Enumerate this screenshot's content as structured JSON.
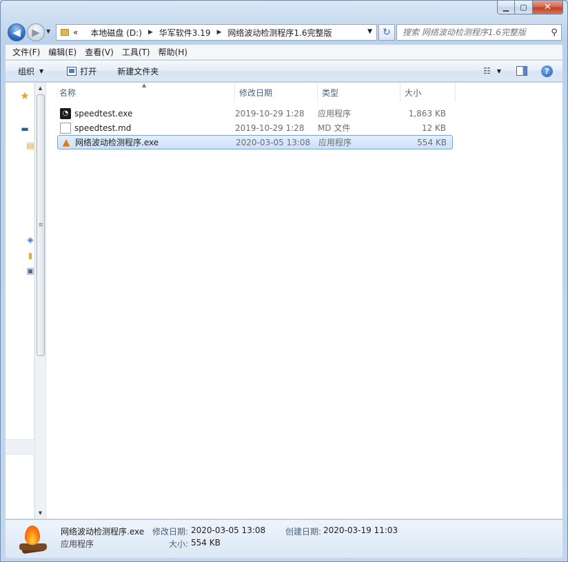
{
  "window": {
    "caption": {
      "minimize": "▁",
      "maximize": "▢",
      "close": "✕"
    }
  },
  "nav": {
    "back": "◀",
    "forward": "▶",
    "history_drop": "▼",
    "breadcrumb": [
      {
        "label": "«"
      },
      {
        "label": "本地磁盘 (D:)"
      },
      {
        "label": "华军软件3.19"
      },
      {
        "label": "网络波动检测程序1.6完整版"
      }
    ],
    "crumb_sep": "▶",
    "address_drop": "▼",
    "refresh": "↻",
    "search_placeholder": "搜索 网络波动检测程序1.6完整版",
    "search_icon": "⚲"
  },
  "menu": [
    "文件(F)",
    "编辑(E)",
    "查看(V)",
    "工具(T)",
    "帮助(H)"
  ],
  "toolbar": {
    "organize": "组织",
    "organize_arrow": "▼",
    "open": "打开",
    "new_folder": "新建文件夹",
    "view_icon": "☷",
    "view_drop": "▼",
    "help": "?"
  },
  "sidebar": {
    "scroll_up": "▲",
    "scroll_down": "▼",
    "thumb_grip": "≡",
    "icons": [
      {
        "name": "favorites-star-icon",
        "glyph": "★",
        "color": "#f0a020"
      },
      {
        "name": "desktop-icon",
        "glyph": "▬",
        "color": "#2c5d9f"
      },
      {
        "name": "library-icon",
        "glyph": "▤",
        "color": "#d0a030"
      },
      {
        "name": "network-icon",
        "glyph": "◈",
        "color": "#2b7bc8"
      },
      {
        "name": "folder-icon",
        "glyph": "▮",
        "color": "#d8b040"
      },
      {
        "name": "computer-icon",
        "glyph": "▣",
        "color": "#4a6a95"
      }
    ]
  },
  "columns": {
    "name": "名称",
    "sort_indicator": "▲",
    "date": "修改日期",
    "type": "类型",
    "size": "大小"
  },
  "files": [
    {
      "name": "speedtest.exe",
      "date": "2019-10-29 1:28",
      "type": "应用程序",
      "size": "1,863 KB",
      "icon": "◔"
    },
    {
      "name": "speedtest.md",
      "date": "2019-10-29 1:28",
      "type": "MD 文件",
      "size": "12 KB",
      "icon": ""
    },
    {
      "name": "网络波动检测程序.exe",
      "date": "2020-03-05 13:08",
      "type": "应用程序",
      "size": "554 KB",
      "icon": "▲"
    }
  ],
  "details": {
    "name": "网络波动检测程序.exe",
    "type": "应用程序",
    "modified_label": "修改日期:",
    "modified": "2020-03-05 13:08",
    "size_label": "大小:",
    "size": "554 KB",
    "created_label": "创建日期:",
    "created": "2020-03-19 11:03"
  }
}
